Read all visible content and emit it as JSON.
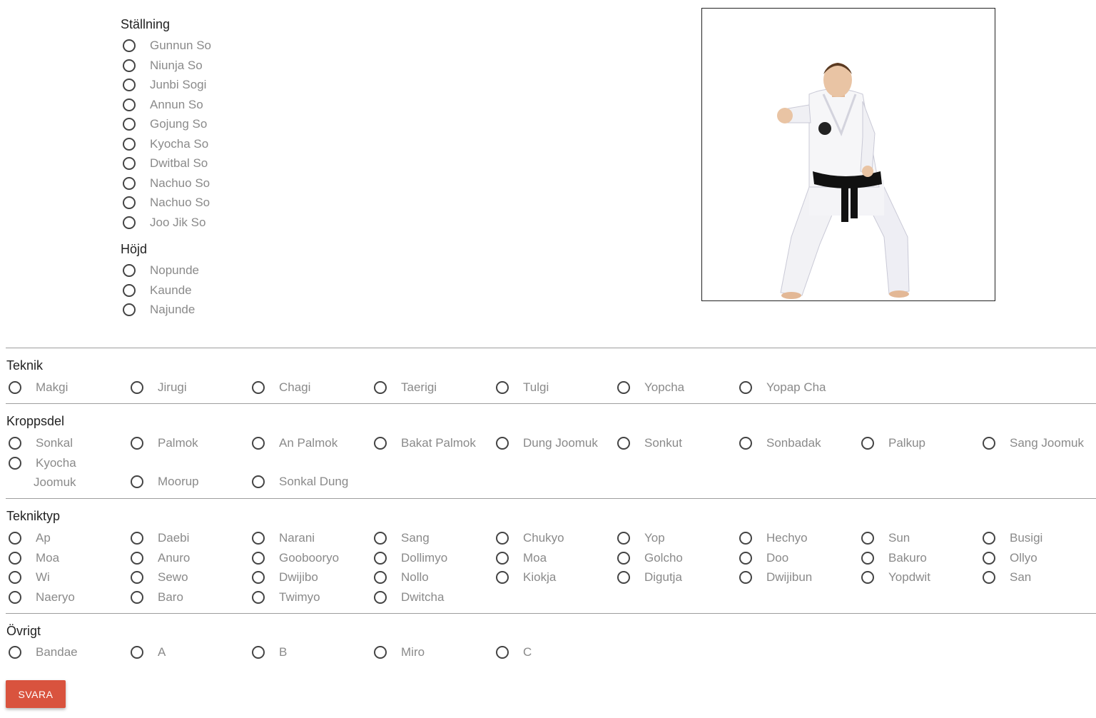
{
  "stallning": {
    "title": "Ställning",
    "options": [
      "Gunnun So",
      "Niunja So",
      "Junbi Sogi",
      "Annun So",
      "Gojung So",
      "Kyocha So",
      "Dwitbal So",
      "Nachuo So",
      "Nachuo So",
      "Joo Jik So"
    ]
  },
  "hojd": {
    "title": "Höjd",
    "options": [
      "Nopunde",
      "Kaunde",
      "Najunde"
    ]
  },
  "teknik": {
    "title": "Teknik",
    "options": [
      "Makgi",
      "Jirugi",
      "Chagi",
      "Taerigi",
      "Tulgi",
      "Yopcha",
      "Yopap Cha"
    ]
  },
  "kroppsdel": {
    "title": "Kroppsdel",
    "row1": [
      "Sonkal",
      "Palmok",
      "An Palmok",
      "Bakat Palmok",
      "Dung Joomuk",
      "Sonkut",
      "Sonbadak",
      "Palkup",
      "Sang Joomuk"
    ],
    "wrapped_first": "Kyocha",
    "wrapped_second": "Joomuk",
    "row2_rest": [
      "Moorup",
      "Sonkal Dung"
    ]
  },
  "tekniktyp": {
    "title": "Tekniktyp",
    "rows": [
      [
        "Ap",
        "Daebi",
        "Narani",
        "Sang",
        "Chukyo",
        "Yop",
        "Hechyo",
        "Sun",
        "Busigi"
      ],
      [
        "Moa",
        "Anuro",
        "Goobooryo",
        "Dollimyo",
        "Moa",
        "Golcho",
        "Doo",
        "Bakuro",
        "Ollyo"
      ],
      [
        "Wi",
        "Sewo",
        "Dwijibo",
        "Nollo",
        "Kiokja",
        "Digutja",
        "Dwijibun",
        "Yopdwit",
        "San"
      ],
      [
        "Naeryo",
        "Baro",
        "Twimyo",
        "Dwitcha"
      ]
    ]
  },
  "ovrigt": {
    "title": "Övrigt",
    "options": [
      "Bandae",
      "A",
      "B",
      "Miro",
      "C"
    ]
  },
  "submit_label": "SVARA",
  "colors": {
    "accent": "#d9533e",
    "label": "#8a8a8a",
    "radio": "#444444"
  }
}
